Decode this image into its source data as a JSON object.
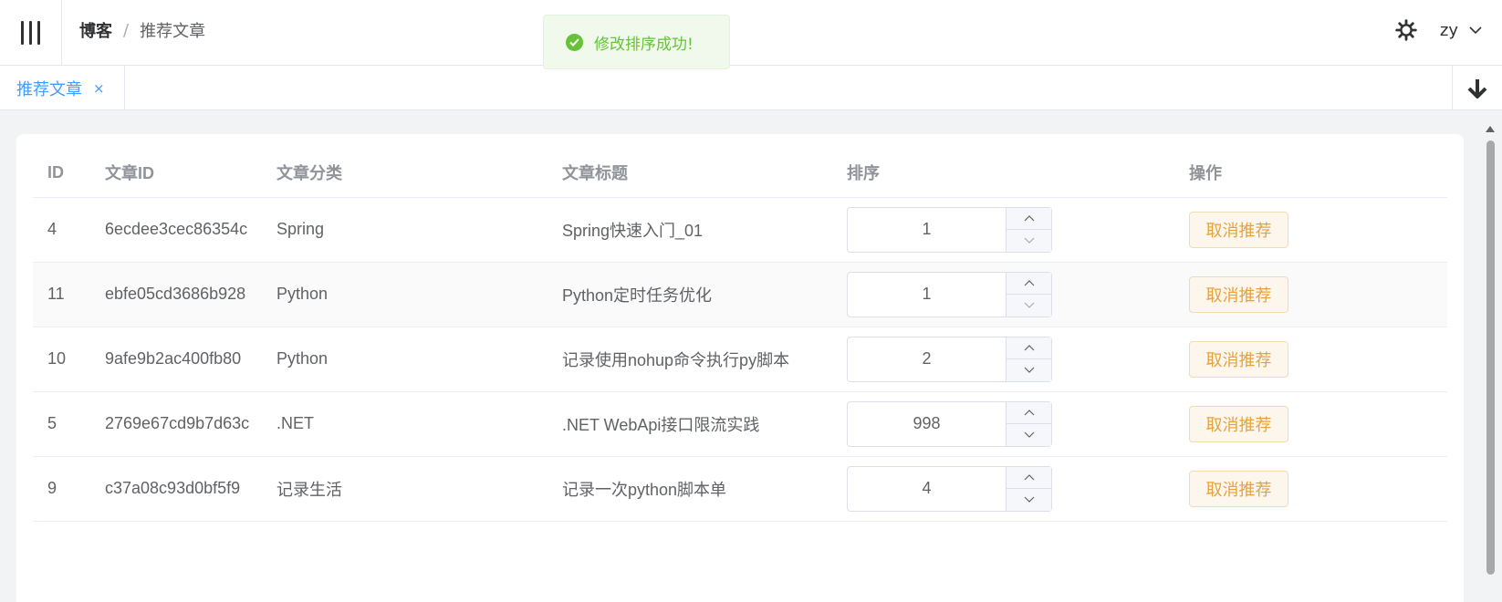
{
  "breadcrumb": {
    "first": "博客",
    "sep": "/",
    "current": "推荐文章"
  },
  "user": {
    "name": "zy"
  },
  "toast": {
    "message": "修改排序成功!"
  },
  "tabs": [
    {
      "label": "推荐文章",
      "close": "×"
    }
  ],
  "table": {
    "headers": {
      "id": "ID",
      "article_id": "文章ID",
      "category": "文章分类",
      "title": "文章标题",
      "sort": "排序",
      "action": "操作"
    },
    "rows": [
      {
        "id": "4",
        "article_id": "6ecdee3cec86354c",
        "category": "Spring",
        "title": "Spring快速入门_01",
        "sort": "1",
        "action": "取消推荐"
      },
      {
        "id": "11",
        "article_id": "ebfe05cd3686b928",
        "category": "Python",
        "title": "Python定时任务优化",
        "sort": "1",
        "action": "取消推荐"
      },
      {
        "id": "10",
        "article_id": "9afe9b2ac400fb80",
        "category": "Python",
        "title": "记录使用nohup命令执行py脚本",
        "sort": "2",
        "action": "取消推荐"
      },
      {
        "id": "5",
        "article_id": "2769e67cd9b7d63c",
        "category": ".NET",
        "title": ".NET WebApi接口限流实践",
        "sort": "998",
        "action": "取消推荐"
      },
      {
        "id": "9",
        "article_id": "c37a08c93d0bf5f9",
        "category": "记录生活",
        "title": "记录一次python脚本单",
        "sort": "4",
        "action": "取消推荐"
      }
    ]
  },
  "colors": {
    "accent": "#409eff",
    "success": "#67c23a",
    "warning": "#e6a23c"
  }
}
